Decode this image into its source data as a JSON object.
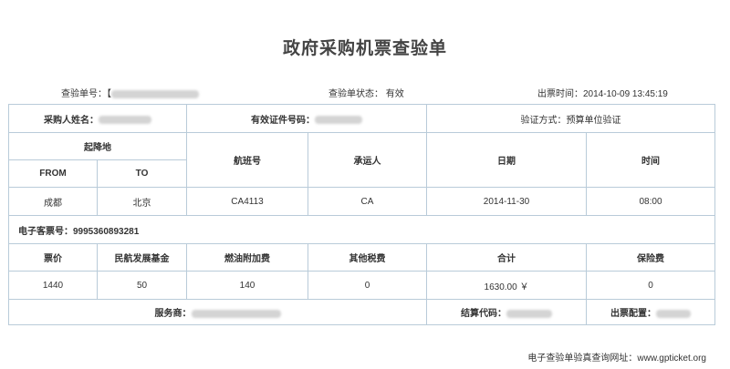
{
  "title": "政府采购机票查验单",
  "meta": {
    "verify_no_label": "查验单号：",
    "verify_no_prefix": "【",
    "status_label": "查验单状态：",
    "status_value": "有效",
    "issue_time_label": "出票时间：",
    "issue_time_value": "2014-10-09 13:45:19"
  },
  "row1": {
    "buyer_label": "采购人姓名：",
    "id_label": "有效证件号码：",
    "verify_method": "验证方式：预算单位验证"
  },
  "flight_header": {
    "route": "起降地",
    "from": "FROM",
    "to": "TO",
    "flight_no": "航班号",
    "carrier": "承运人",
    "date": "日期",
    "time": "时间"
  },
  "flight": {
    "from": "成都",
    "to": "北京",
    "flight_no": "CA4113",
    "carrier": "CA",
    "date": "2014-11-30",
    "time": "08:00"
  },
  "eticket": "电子客票号：9995360893281",
  "fee_header": {
    "fare": "票价",
    "dev_fund": "民航发展基金",
    "fuel": "燃油附加费",
    "other_tax": "其他税费",
    "total": "合计",
    "insurance": "保险费"
  },
  "fees": {
    "fare": "1440",
    "dev_fund": "50",
    "fuel": "140",
    "other_tax": "0",
    "total": "1630.00 ￥",
    "insurance": "0"
  },
  "bottom": {
    "service_label": "服务商：",
    "settle_label": "结算代码：",
    "config_label": "出票配置："
  },
  "footer": "电子查验单验真查询网址：www.gpticket.org"
}
